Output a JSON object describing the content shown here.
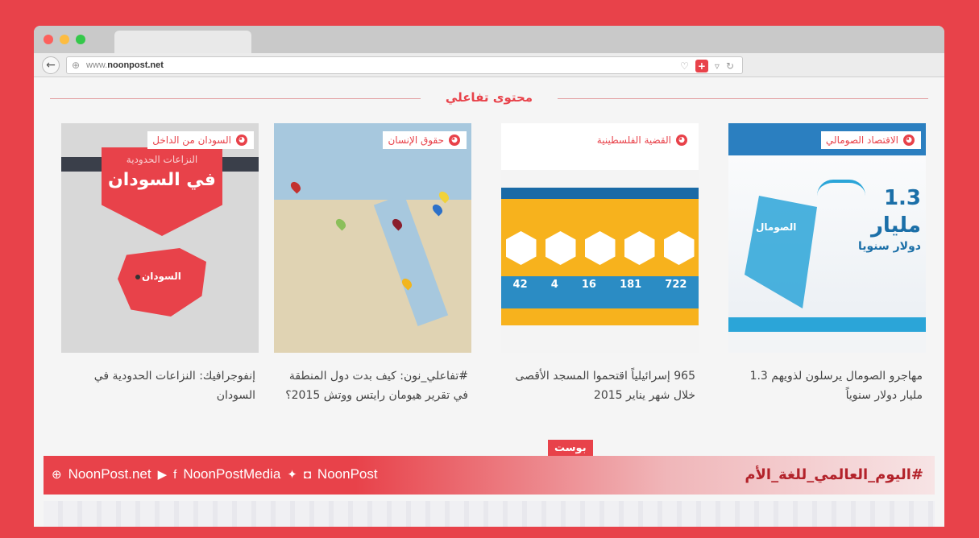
{
  "browser": {
    "url_prefix": "www.",
    "url_domain": "noonpost.net",
    "toolbar_icons": [
      "pocket-icon",
      "add-icon",
      "dropdown-icon",
      "reload-icon"
    ]
  },
  "section": {
    "title": "محتوى تفاعلي"
  },
  "cards": [
    {
      "category": "الاقتصاد الصومالي",
      "title": "مهاجرو الصومال يرسلون لذويهم 1.3 مليار دولار سنوياً",
      "thumb": {
        "line1": "الصومال",
        "big": "1.3 مليار",
        "line2": "دولار سنويا"
      }
    },
    {
      "category": "القضية الفلسطينية",
      "title": "965 إسرائيلياً اقتحموا المسجد الأقصى خلال شهر يناير 2015",
      "thumb": {
        "stats": [
          "722",
          "181",
          "16",
          "4",
          "42"
        ]
      }
    },
    {
      "category": "حقوق الإنسان",
      "title": "#تفاعلي_نون: كيف بدت دول المنطقة في تقرير هيومان رايتس ووتش 2015؟"
    },
    {
      "category": "السودان من الداخل",
      "title": "إنفوجرافيك: النزاعات الحدودية في السودان",
      "thumb": {
        "banner_top": "النزاعات الحدودية",
        "banner_main": "في السودان",
        "country": "السودان"
      }
    }
  ],
  "footer": {
    "site": "NoonPost.net",
    "media": "NoonPostMedia",
    "social": "NoonPost",
    "hashtag": "#اليوم_العالمي_للغة_الأم",
    "brand": "بوست"
  },
  "colors": {
    "brand": "#e8424a",
    "page_bg": "#f5f5f5"
  }
}
